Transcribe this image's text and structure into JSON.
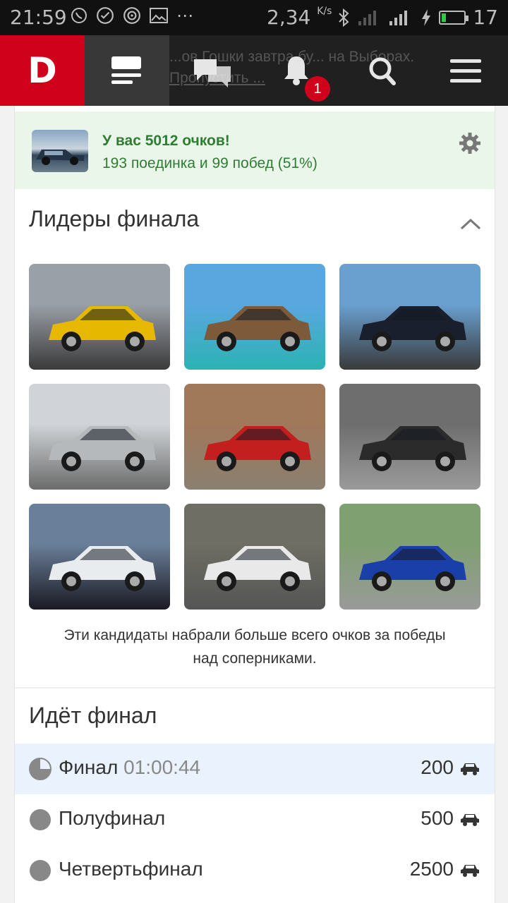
{
  "status_bar": {
    "time": "21:59",
    "net_speed": "2,34",
    "net_unit": "K/s",
    "battery_level": "17",
    "network": "4G"
  },
  "navbar": {
    "logo": "D",
    "ticker_line1": "...ов Гошки завтра бу... на Выборах.",
    "ticker_line2": "Пропустить ...",
    "notifications_count": "1"
  },
  "score": {
    "title": "У вас 5012 очков!",
    "subtitle": "193 поединка и 99 побед (51%)"
  },
  "leaders": {
    "title": "Лидеры финала",
    "photos": [
      {
        "name": "yellow-bmw-photo",
        "colors": [
          "#9aa0a8",
          "#e6b800",
          "#3a3a3a"
        ]
      },
      {
        "name": "teal-bmw-photo",
        "colors": [
          "#5aa7e0",
          "#7d5a3a",
          "#2bb3b3"
        ]
      },
      {
        "name": "black-chaser-photo",
        "colors": [
          "#6aa0d0",
          "#1a1f2e",
          "#3a3a3a"
        ]
      },
      {
        "name": "silver-bmw-photo",
        "colors": [
          "#d0d4d8",
          "#b5b9bc",
          "#6b6b6b"
        ]
      },
      {
        "name": "red-lada-photo",
        "colors": [
          "#a0785a",
          "#c41f1f",
          "#8a8070"
        ]
      },
      {
        "name": "audi-interior-photo",
        "colors": [
          "#6e6e6e",
          "#2b2b2b",
          "#9a9a9a"
        ]
      },
      {
        "name": "dark-coupe-photo",
        "colors": [
          "#6a7f9a",
          "#e8ecef",
          "#1a1a22"
        ]
      },
      {
        "name": "white-saab-photo",
        "colors": [
          "#6e6e64",
          "#e9e9e9",
          "#555555"
        ]
      },
      {
        "name": "blue-bmw-photo",
        "colors": [
          "#7fa070",
          "#1b3fa8",
          "#9a9a9a"
        ]
      }
    ],
    "caption_line1": "Эти кандидаты набрали больше всего очков за победы",
    "caption_line2": "над соперниками."
  },
  "final": {
    "title": "Идёт финал",
    "rounds": [
      {
        "label": "Финал",
        "timer": "01:00:44",
        "points": "200",
        "active": true
      },
      {
        "label": "Полуфинал",
        "timer": "",
        "points": "500",
        "active": false
      },
      {
        "label": "Четвертьфинал",
        "timer": "",
        "points": "2500",
        "active": false
      }
    ]
  },
  "colors": {
    "brand": "#d0021b",
    "score_bg": "#ebf6ea",
    "score_text": "#2e7d32",
    "active_row": "#eaf3fd"
  }
}
